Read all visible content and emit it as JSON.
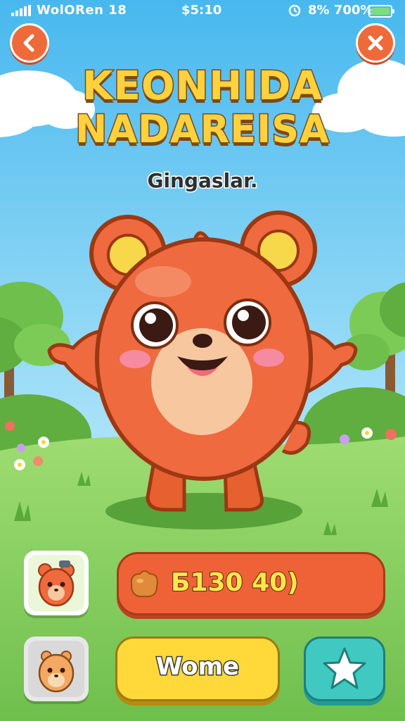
{
  "status_bar": {
    "carrier": "WolORen 18",
    "time": "$5:10",
    "battery_text": "8% 700%"
  },
  "title": {
    "line1": "KEONHIDA",
    "line2": "NADAREISA"
  },
  "subtitle": "Gingaslar.",
  "currency": {
    "value": "Б130 40)"
  },
  "buttons": {
    "home_label": "Wome"
  },
  "icons": {
    "back": "chevron-left-icon",
    "close": "close-icon",
    "currency": "nugget-icon",
    "favorite": "star-icon"
  },
  "colors": {
    "sky_top": "#47b8ee",
    "grass": "#8fd46a",
    "character": "#ef6a3f",
    "accent_orange": "#ef6237",
    "accent_yellow": "#ffd93a",
    "accent_teal": "#40c9c0"
  }
}
